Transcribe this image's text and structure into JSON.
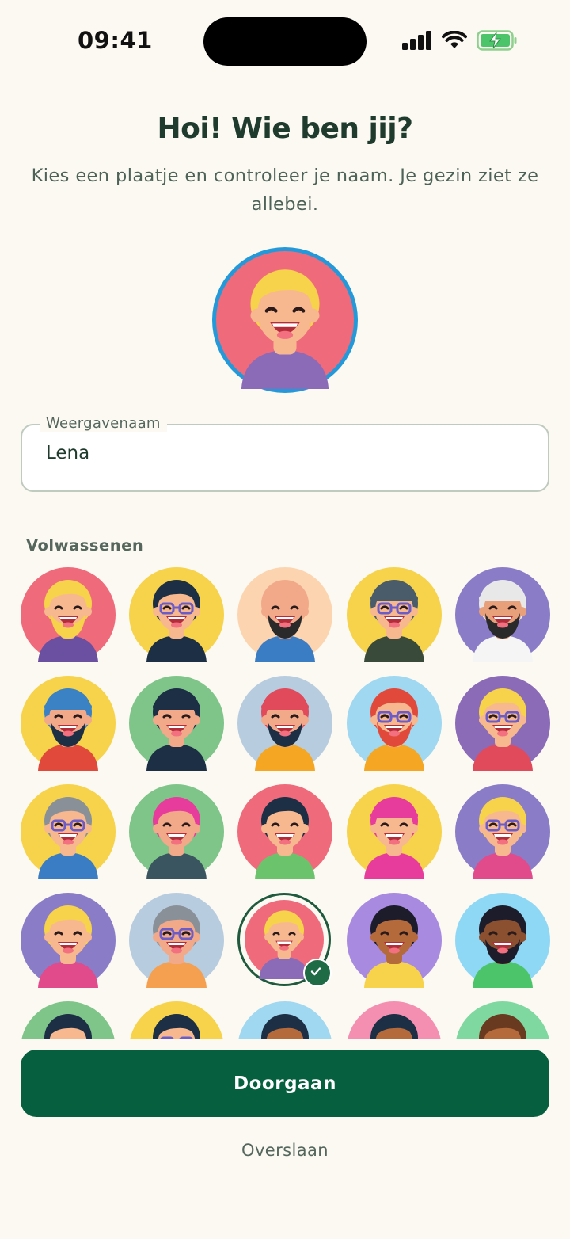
{
  "status_bar": {
    "time": "09:41"
  },
  "header": {
    "title": "Hoi! Wie ben jij?",
    "subtitle": "Kies een plaatje en controleer je naam. Je gezin ziet ze allebei."
  },
  "name_field": {
    "label": "Weergavenaam",
    "value": "Lena"
  },
  "avatar_section": {
    "label": "Volwassenen"
  },
  "avatars": [
    {
      "bg": "#EF6B7B",
      "skin": "#F7B890",
      "hair": "#F6D34A",
      "beard": "#F6D34A",
      "shirt": "#6B4FA0",
      "glasses": false,
      "hat": false
    },
    {
      "bg": "#F6D34A",
      "skin": "#F7B890",
      "hair": "#1C2F45",
      "beard": "",
      "shirt": "#1C2F45",
      "glasses": true,
      "hat": false
    },
    {
      "bg": "#FCD5B0",
      "skin": "#F2A98A",
      "hair": "#F2A98A",
      "beard": "#2A2A2A",
      "shirt": "#3B7DC4",
      "glasses": false,
      "hat": false
    },
    {
      "bg": "#F6D34A",
      "skin": "#F7B890",
      "hair": "#4A5C6A",
      "beard": "",
      "shirt": "#3A4A3A",
      "glasses": true,
      "hat": true
    },
    {
      "bg": "#8B7CC8",
      "skin": "#E8A07A",
      "hair": "#E8E8E8",
      "beard": "#2A2A2A",
      "shirt": "#F5F5F5",
      "glasses": false,
      "hat": true
    },
    {
      "bg": "#F6D34A",
      "skin": "#F2A98A",
      "hair": "#3B82C4",
      "beard": "#1C2F45",
      "shirt": "#E14A3B",
      "glasses": false,
      "hat": true
    },
    {
      "bg": "#7FC58A",
      "skin": "#F2A98A",
      "hair": "#1C2F45",
      "beard": "",
      "shirt": "#1C2F45",
      "glasses": false,
      "hat": true
    },
    {
      "bg": "#B8CCE0",
      "skin": "#F2A98A",
      "hair": "#E14A5B",
      "beard": "#1C2F45",
      "shirt": "#F5A623",
      "glasses": false,
      "hat": true
    },
    {
      "bg": "#9FD8F0",
      "skin": "#F7B890",
      "hair": "#E14A3B",
      "beard": "#E14A3B",
      "shirt": "#F5A623",
      "glasses": true,
      "hat": false
    },
    {
      "bg": "#8B6BB8",
      "skin": "#F7B890",
      "hair": "#F6D34A",
      "beard": "",
      "shirt": "#E14A5B",
      "glasses": true,
      "hat": false
    },
    {
      "bg": "#F6D34A",
      "skin": "#F7B890",
      "hair": "#8A9098",
      "beard": "",
      "shirt": "#3B7DC4",
      "glasses": true,
      "hat": false
    },
    {
      "bg": "#7FC58A",
      "skin": "#F2A98A",
      "hair": "#E83C9C",
      "beard": "",
      "shirt": "#3A5560",
      "glasses": false,
      "hat": false
    },
    {
      "bg": "#EF6B7B",
      "skin": "#F7B890",
      "hair": "#1C2F45",
      "beard": "",
      "shirt": "#6BC46B",
      "glasses": false,
      "hat": false
    },
    {
      "bg": "#F6D34A",
      "skin": "#F7B890",
      "hair": "#E83C9C",
      "beard": "",
      "shirt": "#E83C9C",
      "glasses": false,
      "hat": true
    },
    {
      "bg": "#8B7CC8",
      "skin": "#F7B890",
      "hair": "#F6D34A",
      "beard": "",
      "shirt": "#E14A8B",
      "glasses": true,
      "hat": false
    },
    {
      "bg": "#8B7CC8",
      "skin": "#F7B890",
      "hair": "#F6D34A",
      "beard": "",
      "shirt": "#E14A8B",
      "glasses": false,
      "hat": false
    },
    {
      "bg": "#B8CCE0",
      "skin": "#F2A98A",
      "hair": "#8A9098",
      "beard": "",
      "shirt": "#F5A050",
      "glasses": true,
      "hat": false
    },
    {
      "bg": "#EF6B7B",
      "skin": "#F7B890",
      "hair": "#F6D34A",
      "beard": "",
      "shirt": "#8B6BB8",
      "glasses": false,
      "hat": false,
      "selected": true
    },
    {
      "bg": "#A88BE0",
      "skin": "#B56A3C",
      "hair": "#1C1C2A",
      "beard": "",
      "shirt": "#F6D34A",
      "glasses": false,
      "hat": false
    },
    {
      "bg": "#8FD8F5",
      "skin": "#8A5030",
      "hair": "#1C1C2A",
      "beard": "#1C1C2A",
      "shirt": "#4CC46A",
      "glasses": false,
      "hat": false
    },
    {
      "bg": "#7FC58A",
      "skin": "#F7B890",
      "hair": "#1C2F45",
      "beard": "",
      "shirt": "#3B7DC4",
      "glasses": false,
      "hat": false
    },
    {
      "bg": "#F6D34A",
      "skin": "#F7B890",
      "hair": "#1C2F45",
      "beard": "",
      "shirt": "#3B7DC4",
      "glasses": true,
      "hat": false
    },
    {
      "bg": "#9FD8F0",
      "skin": "#B56A3C",
      "hair": "#1C2F45",
      "beard": "",
      "shirt": "#F5A623",
      "glasses": false,
      "hat": false
    },
    {
      "bg": "#F48FB1",
      "skin": "#B56A3C",
      "hair": "#1C2F45",
      "beard": "",
      "shirt": "#3B7DC4",
      "glasses": false,
      "hat": false
    },
    {
      "bg": "#7FD8A0",
      "skin": "#B56A3C",
      "hair": "#6A3A20",
      "beard": "",
      "shirt": "#E14A5B",
      "glasses": false,
      "hat": false
    }
  ],
  "actions": {
    "continue_label": "Doorgaan",
    "skip_label": "Overslaan"
  },
  "colors": {
    "primary": "#06603F",
    "background": "#FBF9F1",
    "title": "#1F3B2D",
    "preview_ring": "#2499D9"
  }
}
